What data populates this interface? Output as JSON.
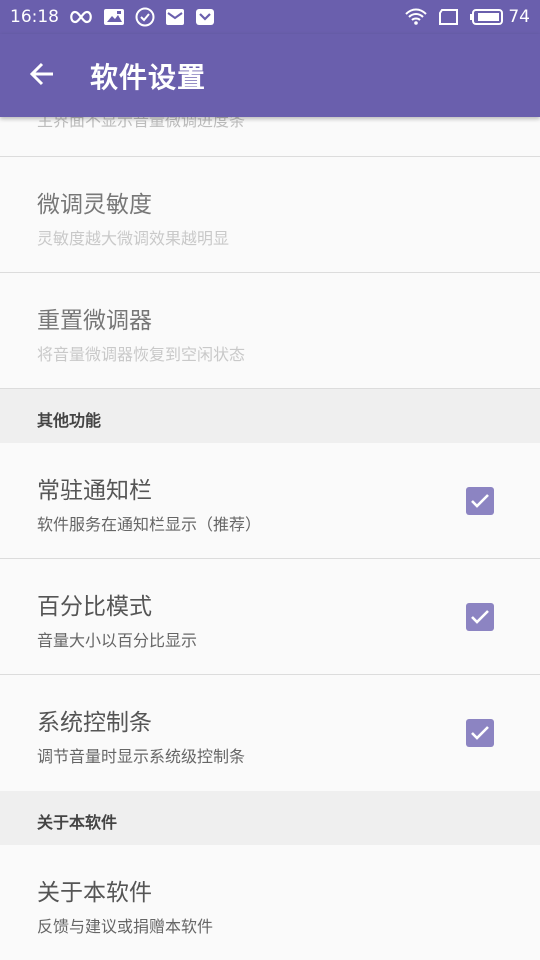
{
  "status_bar": {
    "time": "16:18",
    "battery": "74",
    "left_icons": [
      "infinity-icon",
      "image-icon",
      "check-circle-icon",
      "mail-icon",
      "pocket-icon"
    ],
    "right_icons": [
      "wifi-icon",
      "screen-icon",
      "battery-icon"
    ]
  },
  "app_bar": {
    "title": "软件设置",
    "color": "#6a5fad"
  },
  "partial_item": {
    "subtitle": "主界面不显示音量微调进度条"
  },
  "items_top": [
    {
      "title": "微调灵敏度",
      "subtitle": "灵敏度越大微调效果越明显"
    },
    {
      "title": "重置微调器",
      "subtitle": "将音量微调器恢复到空闲状态"
    }
  ],
  "section_other": {
    "label": "其他功能",
    "items": [
      {
        "title": "常驻通知栏",
        "subtitle": "软件服务在通知栏显示（推荐）",
        "checked": true
      },
      {
        "title": "百分比模式",
        "subtitle": "音量大小以百分比显示",
        "checked": true
      },
      {
        "title": "系统控制条",
        "subtitle": "调节音量时显示系统级控制条",
        "checked": true
      }
    ]
  },
  "section_about": {
    "label": "关于本软件",
    "items": [
      {
        "title": "关于本软件",
        "subtitle": "反馈与建议或捐赠本软件"
      }
    ]
  },
  "colors": {
    "accent": "#6a5fad",
    "checkbox": "#8c84c2",
    "section_bg": "#efefef"
  }
}
